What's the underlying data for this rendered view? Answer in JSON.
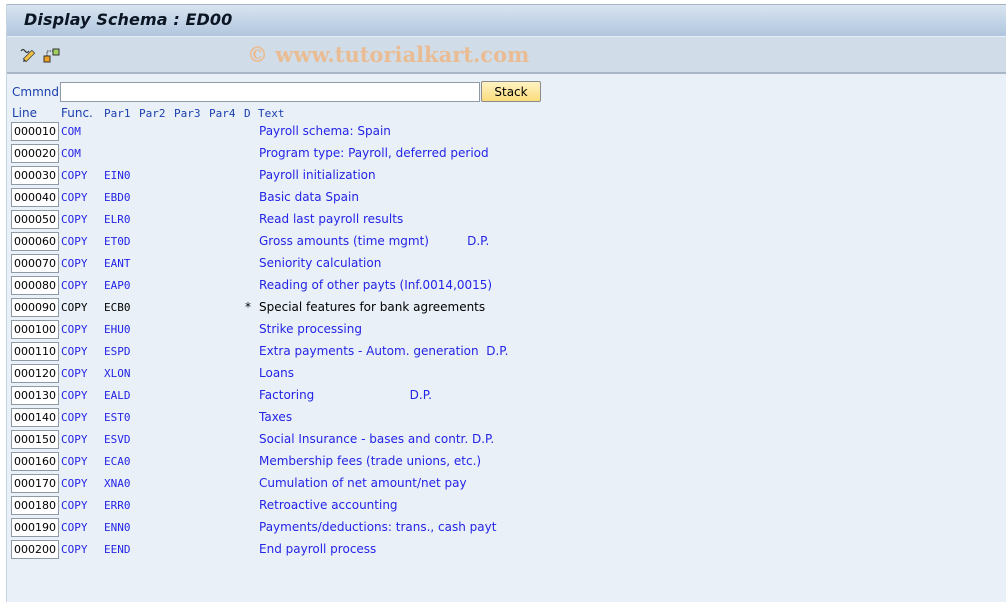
{
  "window": {
    "title": "Display Schema : ED00",
    "watermark": "© www.tutorialkart.com"
  },
  "toolbar": {
    "icons": [
      "display-change-icon",
      "other-object-icon"
    ]
  },
  "command": {
    "label": "Cmmnd",
    "value": "",
    "stack_label": "Stack"
  },
  "columns": {
    "line": "Line",
    "func": "Func.",
    "par1": "Par1",
    "par2": "Par2",
    "par3": "Par3",
    "par4": "Par4",
    "d": "D",
    "text": "Text"
  },
  "rows": [
    {
      "line": "000010",
      "func": "COM",
      "par1": "",
      "d": "",
      "text": "Payroll schema: Spain"
    },
    {
      "line": "000020",
      "func": "COM",
      "par1": "",
      "d": "",
      "text": "Program type: Payroll, deferred period"
    },
    {
      "line": "000030",
      "func": "COPY",
      "par1": "EIN0",
      "d": "",
      "text": "Payroll initialization"
    },
    {
      "line": "000040",
      "func": "COPY",
      "par1": "EBD0",
      "d": "",
      "text": "Basic data Spain"
    },
    {
      "line": "000050",
      "func": "COPY",
      "par1": "ELR0",
      "d": "",
      "text": "Read last payroll results"
    },
    {
      "line": "000060",
      "func": "COPY",
      "par1": "ET0D",
      "d": "",
      "text": "Gross amounts (time mgmt)          D.P."
    },
    {
      "line": "000070",
      "func": "COPY",
      "par1": "EANT",
      "d": "",
      "text": "Seniority calculation"
    },
    {
      "line": "000080",
      "func": "COPY",
      "par1": "EAP0",
      "d": "",
      "text": "Reading of other payts (Inf.0014,0015)"
    },
    {
      "line": "000090",
      "func": "COPY",
      "par1": "ECB0",
      "d": "*",
      "text": "Special features for bank agreements"
    },
    {
      "line": "000100",
      "func": "COPY",
      "par1": "EHU0",
      "d": "",
      "text": "Strike processing"
    },
    {
      "line": "000110",
      "func": "COPY",
      "par1": "ESPD",
      "d": "",
      "text": "Extra payments - Autom. generation  D.P."
    },
    {
      "line": "000120",
      "func": "COPY",
      "par1": "XLON",
      "d": "",
      "text": "Loans"
    },
    {
      "line": "000130",
      "func": "COPY",
      "par1": "EALD",
      "d": "",
      "text": "Factoring                         D.P."
    },
    {
      "line": "000140",
      "func": "COPY",
      "par1": "EST0",
      "d": "",
      "text": "Taxes"
    },
    {
      "line": "000150",
      "func": "COPY",
      "par1": "ESVD",
      "d": "",
      "text": "Social Insurance - bases and contr. D.P."
    },
    {
      "line": "000160",
      "func": "COPY",
      "par1": "ECA0",
      "d": "",
      "text": "Membership fees (trade unions, etc.)"
    },
    {
      "line": "000170",
      "func": "COPY",
      "par1": "XNA0",
      "d": "",
      "text": "Cumulation of net amount/net pay"
    },
    {
      "line": "000180",
      "func": "COPY",
      "par1": "ERR0",
      "d": "",
      "text": "Retroactive accounting"
    },
    {
      "line": "000190",
      "func": "COPY",
      "par1": "ENN0",
      "d": "",
      "text": "Payments/deductions: trans., cash payt"
    },
    {
      "line": "000200",
      "func": "COPY",
      "par1": "EEND",
      "d": "",
      "text": "End payroll process"
    }
  ],
  "colors": {
    "text_blue": "#2424e6",
    "label_blue": "#1b3fae",
    "commented": "#000000",
    "button_yellow": "#fbdc7c"
  }
}
